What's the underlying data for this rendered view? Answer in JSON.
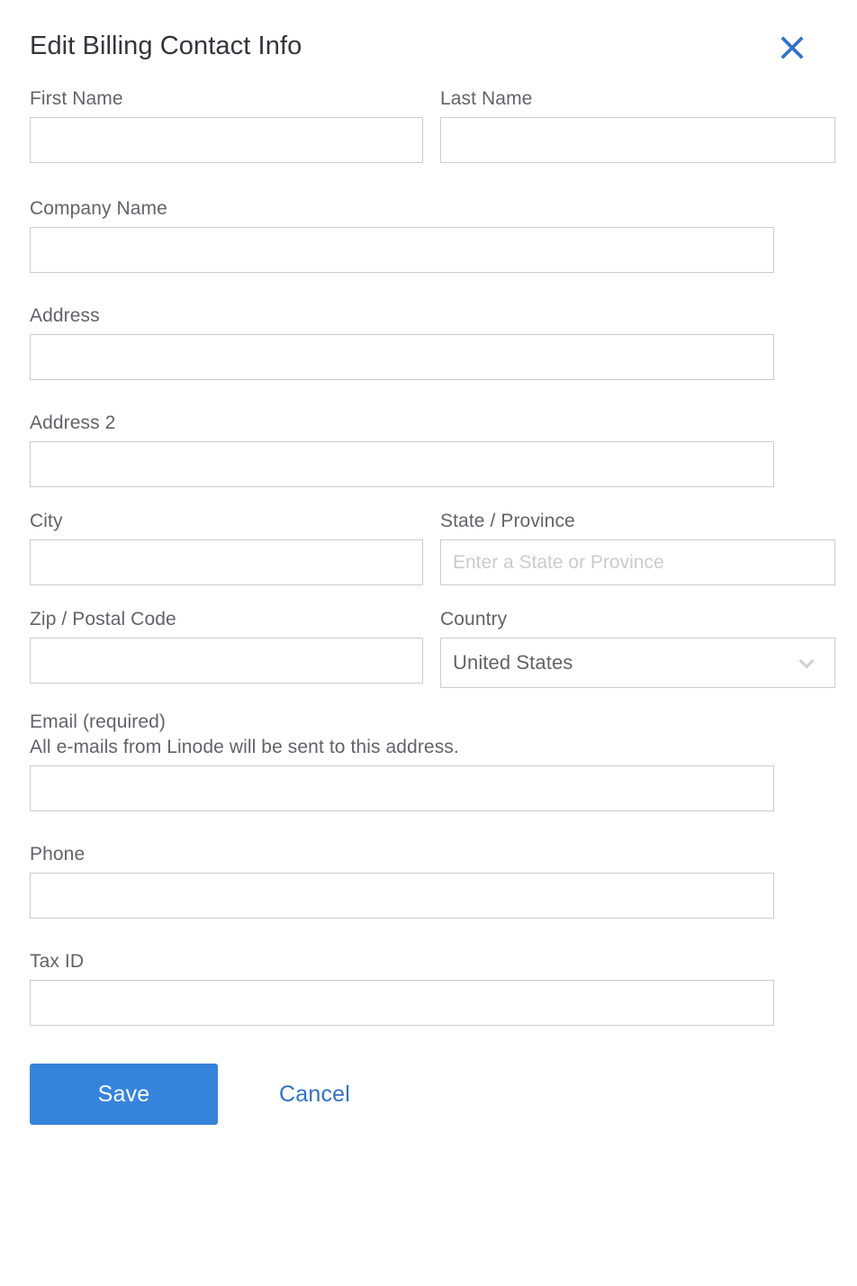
{
  "drawer": {
    "title": "Edit Billing Contact Info",
    "close_icon": "close-icon"
  },
  "colors": {
    "accent_blue": "#3683dc",
    "link_blue": "#3071c8",
    "close_blue": "#3072c8",
    "label_gray": "#606469",
    "title_gray": "#32363c",
    "border_gray": "#cccccc",
    "placeholder_gray": "#cbcbcb"
  },
  "fields": {
    "first_name": {
      "label": "First Name",
      "value": "",
      "placeholder": ""
    },
    "last_name": {
      "label": "Last Name",
      "value": "",
      "placeholder": ""
    },
    "company_name": {
      "label": "Company Name",
      "value": "",
      "placeholder": ""
    },
    "address": {
      "label": "Address",
      "value": "",
      "placeholder": ""
    },
    "address2": {
      "label": "Address 2",
      "value": "",
      "placeholder": ""
    },
    "city": {
      "label": "City",
      "value": "",
      "placeholder": ""
    },
    "state": {
      "label": "State / Province",
      "value": "",
      "placeholder": "Enter a State or Province"
    },
    "zip": {
      "label": "Zip / Postal Code",
      "value": "",
      "placeholder": ""
    },
    "country": {
      "label": "Country",
      "value": "United States",
      "chevron_icon": "chevron-down-icon"
    },
    "email": {
      "label": "Email (required)",
      "help": "All e-mails from Linode will be sent to this address.",
      "value": "",
      "placeholder": ""
    },
    "phone": {
      "label": "Phone",
      "value": "",
      "placeholder": ""
    },
    "tax_id": {
      "label": "Tax ID",
      "value": "",
      "placeholder": ""
    }
  },
  "actions": {
    "save_label": "Save",
    "cancel_label": "Cancel"
  }
}
